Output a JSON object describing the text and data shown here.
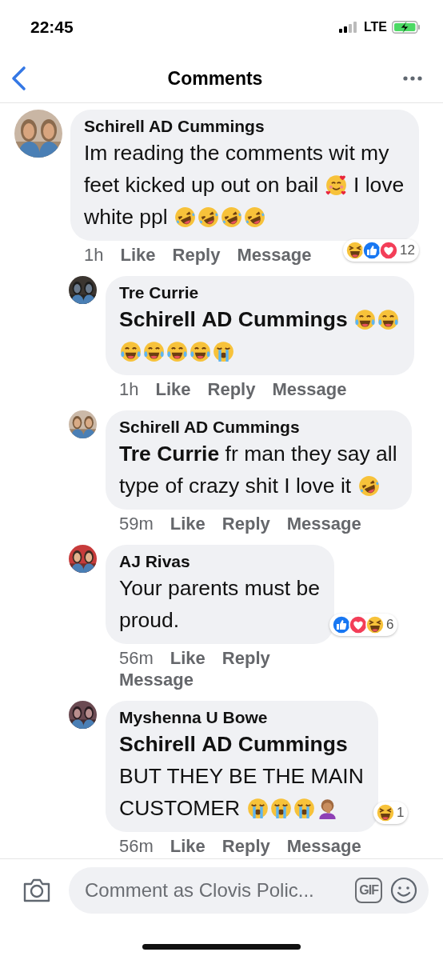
{
  "status_bar": {
    "time": "22:45",
    "network": "LTE"
  },
  "header": {
    "title": "Comments"
  },
  "comments": [
    {
      "author": "Schirell AD Cummings",
      "body": [
        {
          "kind": "text",
          "text": "Im reading the comments wit my feet kicked up out on bail"
        },
        {
          "kind": "hearts_face"
        },
        {
          "kind": "text",
          "text": "I love white ppl"
        },
        {
          "kind": "rolling_laugh"
        },
        {
          "kind": "rolling_laugh"
        },
        {
          "kind": "rolling_laugh"
        },
        {
          "kind": "rolling_laugh"
        }
      ],
      "time": "1h",
      "actions": [
        "Like",
        "Reply",
        "Message"
      ],
      "reactions": [
        {
          "kind": "laugh"
        },
        {
          "kind": "like"
        },
        {
          "kind": "love"
        }
      ],
      "reaction_count": "12",
      "replies": [
        {
          "author": "Tre Currie",
          "body": [
            {
              "kind": "text",
              "text": "**Schirell AD Cummings**"
            },
            {
              "kind": "tears_laugh"
            },
            {
              "kind": "tears_laugh"
            },
            {
              "kind": "tears_laugh"
            },
            {
              "kind": "tears_laugh"
            },
            {
              "kind": "tears_laugh"
            },
            {
              "kind": "tears_laugh"
            },
            {
              "kind": "crying"
            }
          ],
          "time": "1h",
          "actions": [
            "Like",
            "Reply",
            "Message"
          ]
        },
        {
          "author": "Schirell AD Cummings",
          "body": [
            {
              "kind": "text",
              "text": "**Tre Currie** fr man they say all type of crazy shit I love it"
            },
            {
              "kind": "rolling_laugh"
            }
          ],
          "time": "59m",
          "actions": [
            "Like",
            "Reply",
            "Message"
          ]
        },
        {
          "author": "AJ Rivas",
          "body": [
            {
              "kind": "text",
              "text": "Your parents must be proud."
            }
          ],
          "time": "56m",
          "actions": [
            "Like",
            "Reply",
            "Message"
          ],
          "reactions": [
            {
              "kind": "like"
            },
            {
              "kind": "love"
            },
            {
              "kind": "laugh"
            }
          ],
          "reaction_count": "6"
        },
        {
          "author": "Myshenna U Bowe",
          "body": [
            {
              "kind": "text",
              "text": "**Schirell AD Cummings** BUT THEY BE THE MAIN CUSTOMER"
            },
            {
              "kind": "crying"
            },
            {
              "kind": "crying"
            },
            {
              "kind": "crying"
            },
            {
              "kind": "facepalm"
            }
          ],
          "time": "56m",
          "actions": [
            "Like",
            "Reply",
            "Message"
          ],
          "reactions": [
            {
              "kind": "laugh"
            }
          ],
          "reaction_count": "1"
        }
      ]
    }
  ],
  "composer": {
    "placeholder": "Comment as Clovis Polic...",
    "gif": "GIF"
  }
}
